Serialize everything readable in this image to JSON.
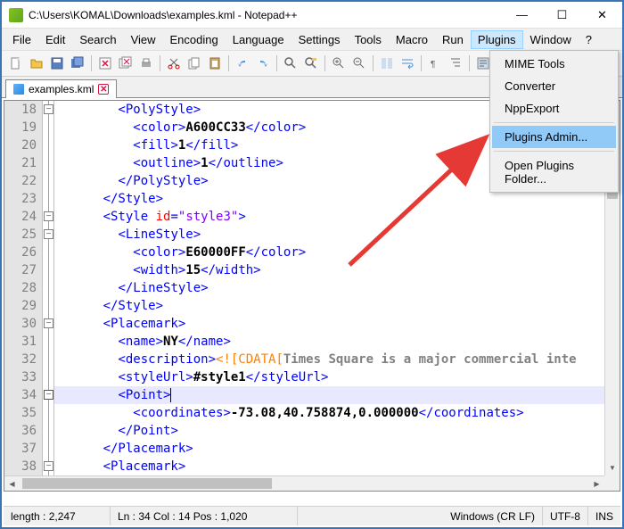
{
  "window": {
    "title": "C:\\Users\\KOMAL\\Downloads\\examples.kml - Notepad++",
    "min": "—",
    "max": "☐",
    "close": "✕"
  },
  "menu": {
    "items": [
      "File",
      "Edit",
      "Search",
      "View",
      "Encoding",
      "Language",
      "Settings",
      "Tools",
      "Macro",
      "Run",
      "Plugins",
      "Window",
      "?"
    ]
  },
  "plugins_dropdown": {
    "items": [
      "MIME Tools",
      "Converter",
      "NppExport"
    ],
    "sep1": true,
    "admin": "Plugins Admin...",
    "sep2": true,
    "open_folder": "Open Plugins Folder..."
  },
  "tab": {
    "label": "examples.kml"
  },
  "code": {
    "line_numbers": [
      18,
      19,
      20,
      21,
      22,
      23,
      24,
      25,
      26,
      27,
      28,
      29,
      30,
      31,
      32,
      33,
      34,
      35,
      36,
      37,
      38
    ],
    "lines": [
      {
        "indent": 8,
        "parts": [
          {
            "t": "tag",
            "v": "<PolyStyle>"
          }
        ]
      },
      {
        "indent": 10,
        "parts": [
          {
            "t": "tag",
            "v": "<color>"
          },
          {
            "t": "txt",
            "v": "A600CC33"
          },
          {
            "t": "tag",
            "v": "</color>"
          }
        ]
      },
      {
        "indent": 10,
        "parts": [
          {
            "t": "tag",
            "v": "<fill>"
          },
          {
            "t": "txt",
            "v": "1"
          },
          {
            "t": "tag",
            "v": "</fill>"
          }
        ]
      },
      {
        "indent": 10,
        "parts": [
          {
            "t": "tag",
            "v": "<outline>"
          },
          {
            "t": "txt",
            "v": "1"
          },
          {
            "t": "tag",
            "v": "</outline>"
          }
        ]
      },
      {
        "indent": 8,
        "parts": [
          {
            "t": "tag",
            "v": "</PolyStyle>"
          }
        ]
      },
      {
        "indent": 6,
        "parts": [
          {
            "t": "tag",
            "v": "</Style>"
          }
        ]
      },
      {
        "indent": 6,
        "parts": [
          {
            "t": "tag",
            "v": "<Style "
          },
          {
            "t": "attr",
            "v": "id"
          },
          {
            "t": "tag",
            "v": "="
          },
          {
            "t": "val",
            "v": "\"style3\""
          },
          {
            "t": "tag",
            "v": ">"
          }
        ]
      },
      {
        "indent": 8,
        "parts": [
          {
            "t": "tag",
            "v": "<LineStyle>"
          }
        ]
      },
      {
        "indent": 10,
        "parts": [
          {
            "t": "tag",
            "v": "<color>"
          },
          {
            "t": "txt",
            "v": "E60000FF"
          },
          {
            "t": "tag",
            "v": "</color>"
          }
        ]
      },
      {
        "indent": 10,
        "parts": [
          {
            "t": "tag",
            "v": "<width>"
          },
          {
            "t": "txt",
            "v": "15"
          },
          {
            "t": "tag",
            "v": "</width>"
          }
        ]
      },
      {
        "indent": 8,
        "parts": [
          {
            "t": "tag",
            "v": "</LineStyle>"
          }
        ]
      },
      {
        "indent": 6,
        "parts": [
          {
            "t": "tag",
            "v": "</Style>"
          }
        ]
      },
      {
        "indent": 6,
        "parts": [
          {
            "t": "tag",
            "v": "<Placemark>"
          }
        ]
      },
      {
        "indent": 8,
        "parts": [
          {
            "t": "tag",
            "v": "<name>"
          },
          {
            "t": "txt",
            "v": "NY"
          },
          {
            "t": "tag",
            "v": "</name>"
          }
        ]
      },
      {
        "indent": 8,
        "parts": [
          {
            "t": "tag",
            "v": "<description>"
          },
          {
            "t": "cdata",
            "v": "<![CDATA["
          },
          {
            "t": "cdata2",
            "v": "Times Square is a major commercial inte"
          }
        ]
      },
      {
        "indent": 8,
        "parts": [
          {
            "t": "tag",
            "v": "<styleUrl>"
          },
          {
            "t": "txt",
            "v": "#style1"
          },
          {
            "t": "tag",
            "v": "</styleUrl>"
          }
        ]
      },
      {
        "indent": 8,
        "hl": true,
        "caret": true,
        "parts": [
          {
            "t": "tag",
            "v": "<Point>"
          }
        ]
      },
      {
        "indent": 10,
        "parts": [
          {
            "t": "tag",
            "v": "<coordinates>"
          },
          {
            "t": "txt",
            "v": "-73.08,40.758874,0.000000"
          },
          {
            "t": "tag",
            "v": "</coordinates>"
          }
        ]
      },
      {
        "indent": 8,
        "parts": [
          {
            "t": "tag",
            "v": "</Point>"
          }
        ]
      },
      {
        "indent": 6,
        "parts": [
          {
            "t": "tag",
            "v": "</Placemark>"
          }
        ]
      },
      {
        "indent": 6,
        "parts": [
          {
            "t": "tag",
            "v": "<Placemark>"
          }
        ]
      }
    ]
  },
  "status": {
    "length": "length : 2,247",
    "pos": "Ln : 34   Col : 14   Pos : 1,020",
    "eol": "Windows (CR LF)",
    "enc": "UTF-8",
    "ins": "INS"
  }
}
